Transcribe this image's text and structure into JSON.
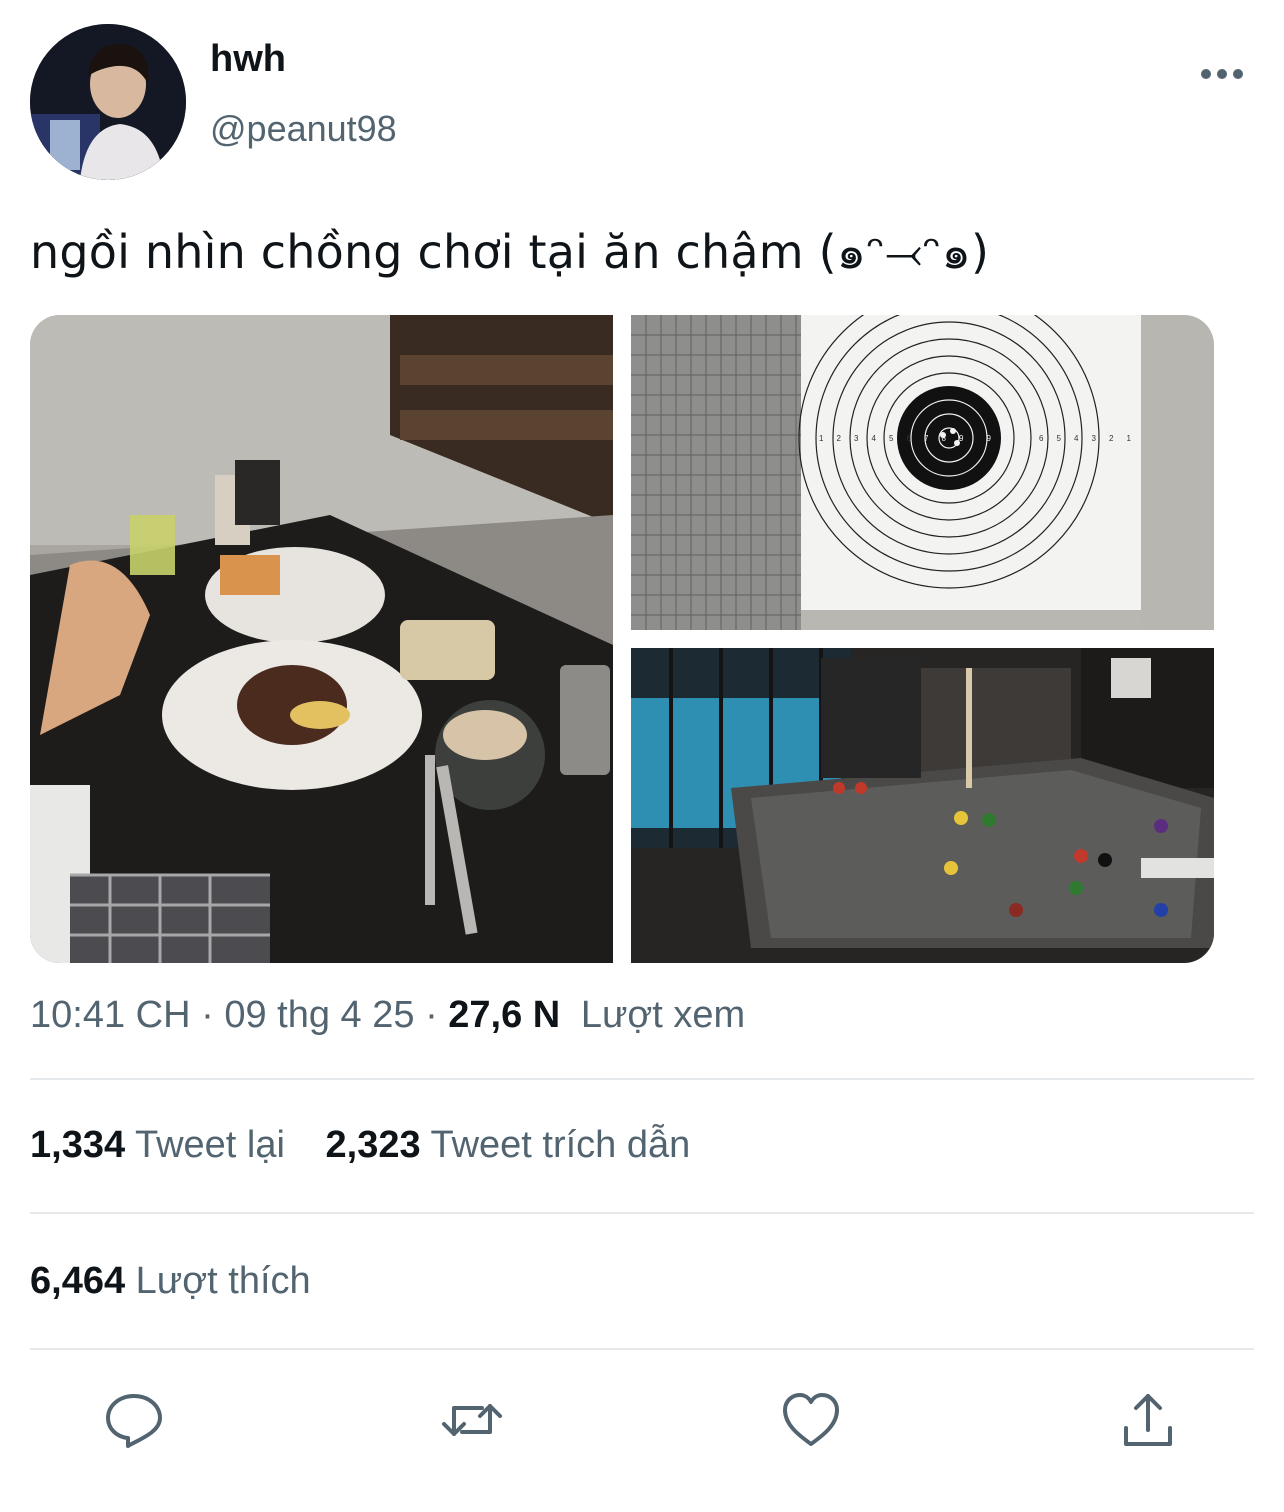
{
  "tweet": {
    "display_name": "hwh",
    "handle": "@peanut98",
    "more_icon": "more-horizontal-icon",
    "text": "ngồi nhìn chồng chơi tại ăn chậm (๑ᵔ⤙ᵔ๑)",
    "photos": [
      {
        "name": "photo-breakfast-table"
      },
      {
        "name": "photo-shooting-target"
      },
      {
        "name": "photo-billiards-table"
      }
    ],
    "target_labels": [
      "1",
      "2",
      "3",
      "4",
      "5",
      "6",
      "7",
      "8",
      "9",
      "9",
      "8",
      "7",
      "6",
      "5",
      "4",
      "3",
      "2",
      "1"
    ],
    "meta": {
      "time": "10:41 CH",
      "separator": "·",
      "date": "09 thg 4 25",
      "views_count": "27,6 N",
      "views_label": "Lượt xem"
    },
    "stats": {
      "retweets_count": "1,334",
      "retweets_label": "Tweet lại",
      "quotes_count": "2,323",
      "quotes_label": "Tweet trích dẫn",
      "likes_count": "6,464",
      "likes_label": "Lượt thích"
    },
    "actions": [
      "reply-icon",
      "retweet-icon",
      "like-icon",
      "share-icon"
    ]
  },
  "colors": {
    "text": "#0f1419",
    "secondary": "#536471",
    "divider": "#e6e9ec"
  }
}
